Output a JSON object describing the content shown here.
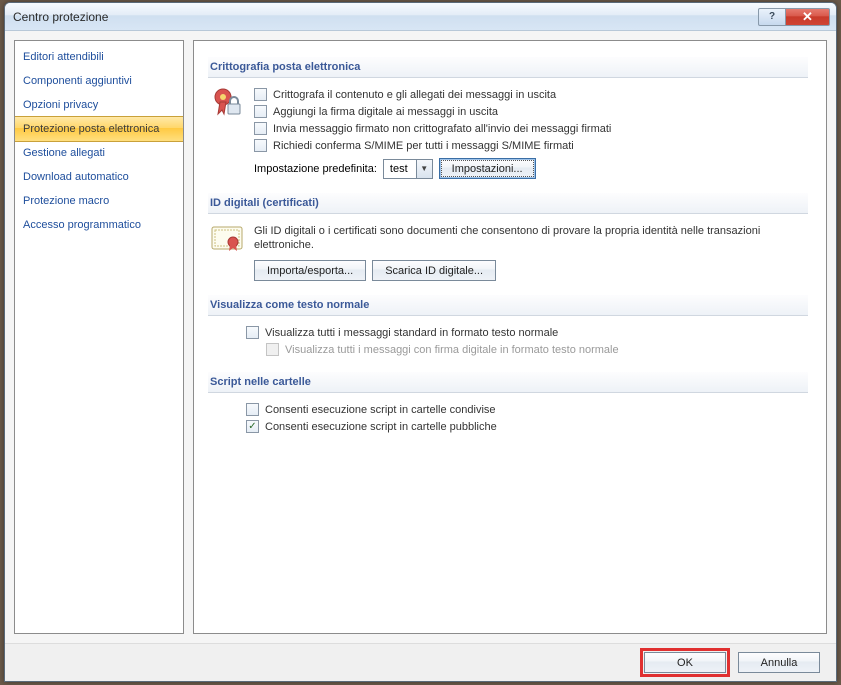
{
  "window": {
    "title": "Centro protezione"
  },
  "sidebar": {
    "items": [
      {
        "label": "Editori attendibili"
      },
      {
        "label": "Componenti aggiuntivi"
      },
      {
        "label": "Opzioni privacy"
      },
      {
        "label": "Protezione posta elettronica",
        "selected": true
      },
      {
        "label": "Gestione allegati"
      },
      {
        "label": "Download automatico"
      },
      {
        "label": "Protezione macro"
      },
      {
        "label": "Accesso programmatico"
      }
    ]
  },
  "sections": {
    "crypto": {
      "heading": "Crittografia posta elettronica",
      "opt_encrypt": "Crittografa il contenuto e gli allegati dei messaggi in uscita",
      "opt_sign": "Aggiungi la firma digitale ai messaggi in uscita",
      "opt_cleartext": "Invia messaggio firmato non crittografato all'invio dei messaggi firmati",
      "opt_smime": "Richiedi conferma S/MIME per tutti i messaggi S/MIME firmati",
      "default_label": "Impostazione predefinita:",
      "default_value": "test",
      "settings_btn": "Impostazioni..."
    },
    "digitalid": {
      "heading": "ID digitali (certificati)",
      "desc": "Gli ID digitali o i certificati sono documenti che consentono di provare la propria identità nelle transazioni elettroniche.",
      "import_btn": "Importa/esporta...",
      "download_btn": "Scarica ID digitale..."
    },
    "plaintext": {
      "heading": "Visualizza come testo normale",
      "opt_all": "Visualizza tutti i messaggi standard in formato testo normale",
      "opt_signed": "Visualizza tutti i messaggi con firma digitale in formato testo normale"
    },
    "script": {
      "heading": "Script nelle cartelle",
      "opt_shared": "Consenti esecuzione script in cartelle condivise",
      "opt_public": "Consenti esecuzione script in cartelle pubbliche"
    }
  },
  "footer": {
    "ok": "OK",
    "cancel": "Annulla"
  }
}
